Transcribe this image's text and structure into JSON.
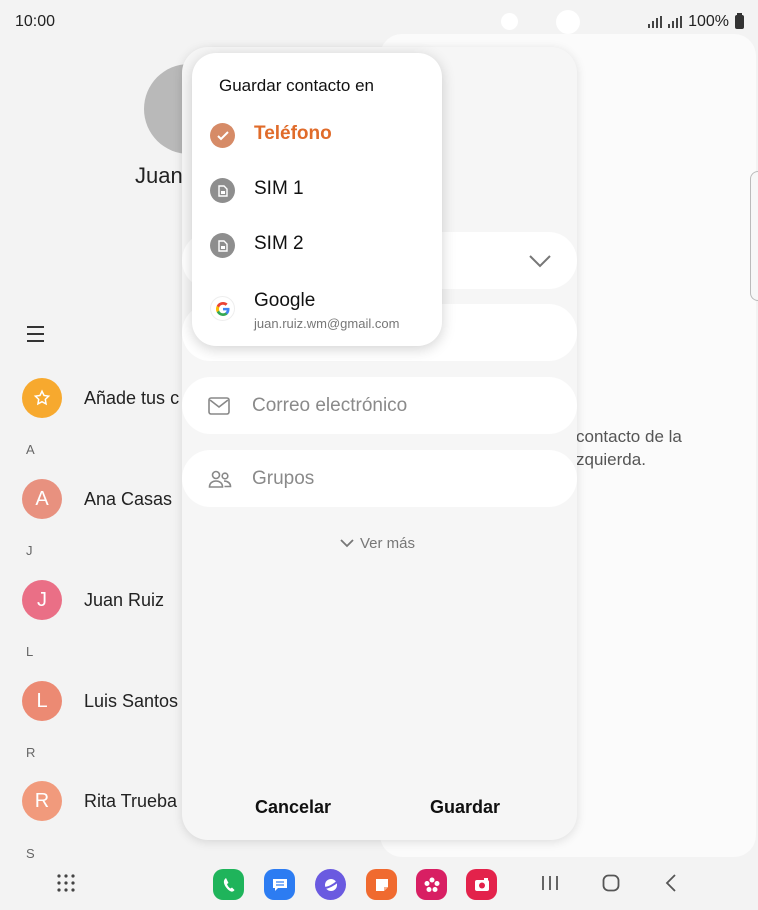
{
  "status": {
    "time": "10:00",
    "battery": "100%"
  },
  "contact_header": {
    "name": "Juan"
  },
  "list": {
    "favorites_label": "Añade tus c",
    "sections": [
      {
        "letter": "A",
        "name": "Ana Casas",
        "initial": "A",
        "color": "#e8917f"
      },
      {
        "letter": "J",
        "name": "Juan Ruiz",
        "initial": "J",
        "color": "#ea6f86"
      },
      {
        "letter": "L",
        "name": "Luis Santos",
        "initial": "L",
        "color": "#ec8a73"
      },
      {
        "letter": "R",
        "name": "Rita Trueba",
        "initial": "R",
        "color": "#f19a7c"
      },
      {
        "letter": "S"
      }
    ]
  },
  "right_panel": {
    "message_line1": "contacto de la",
    "message_line2": "zquierda."
  },
  "dialog": {
    "email_label": "Correo electrónico",
    "groups_label": "Grupos",
    "ver_mas": "Ver más",
    "cancel": "Cancelar",
    "save": "Guardar"
  },
  "popup": {
    "title": "Guardar contacto en",
    "options": [
      {
        "label": "Teléfono",
        "icon": "phone-storage-icon",
        "selected": true
      },
      {
        "label": "SIM 1",
        "icon": "sim-card-icon"
      },
      {
        "label": "SIM 2",
        "icon": "sim-card-icon"
      },
      {
        "label": "Google",
        "sub": "juan.ruiz.wm@gmail.com",
        "icon": "google-icon"
      }
    ]
  },
  "colors": {
    "accent": "#e06b2a",
    "favorite": "#f7a92e"
  }
}
